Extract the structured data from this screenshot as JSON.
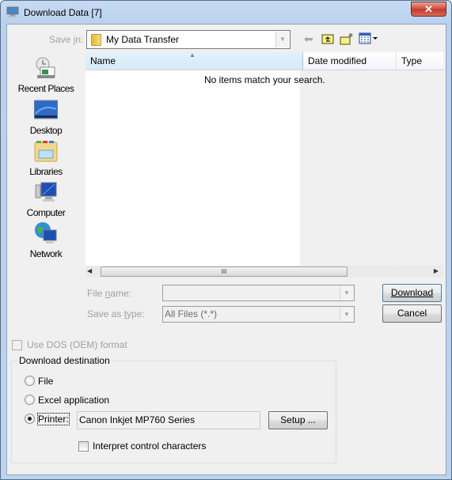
{
  "window": {
    "title": "Download Data [7]",
    "close_label": "✕"
  },
  "save_in": {
    "label": "Save in:",
    "value": "My Data Transfer"
  },
  "toolbar": {
    "back_icon": "back-arrow-icon",
    "up_icon": "up-folder-icon",
    "new_folder_icon": "new-folder-icon",
    "views_icon": "views-menu-icon"
  },
  "places": [
    {
      "label": "Recent Places",
      "icon": "recent-places-icon"
    },
    {
      "label": "Desktop",
      "icon": "desktop-icon"
    },
    {
      "label": "Libraries",
      "icon": "libraries-icon"
    },
    {
      "label": "Computer",
      "icon": "computer-icon"
    },
    {
      "label": "Network",
      "icon": "network-icon"
    }
  ],
  "file_list": {
    "columns": [
      "Name",
      "Date modified",
      "Type"
    ],
    "empty_message": "No items match your search.",
    "scroll_grip": "III"
  },
  "file_name": {
    "label": "File name:",
    "value": ""
  },
  "save_as_type": {
    "label": "Save as type:",
    "value": "All Files (*.*)"
  },
  "buttons": {
    "download": "Download",
    "cancel": "Cancel",
    "setup": "Setup ..."
  },
  "dos_format": {
    "label": "Use DOS (OEM) format",
    "checked": false,
    "enabled": false
  },
  "destination": {
    "title": "Download destination",
    "options": [
      {
        "label": "File",
        "selected": false
      },
      {
        "label": "Excel application",
        "selected": false
      },
      {
        "label": "Printer:",
        "selected": true
      }
    ],
    "printer_name": "Canon Inkjet MP760 Series",
    "interpret_control": {
      "label": "Interpret control characters",
      "checked": false
    }
  }
}
